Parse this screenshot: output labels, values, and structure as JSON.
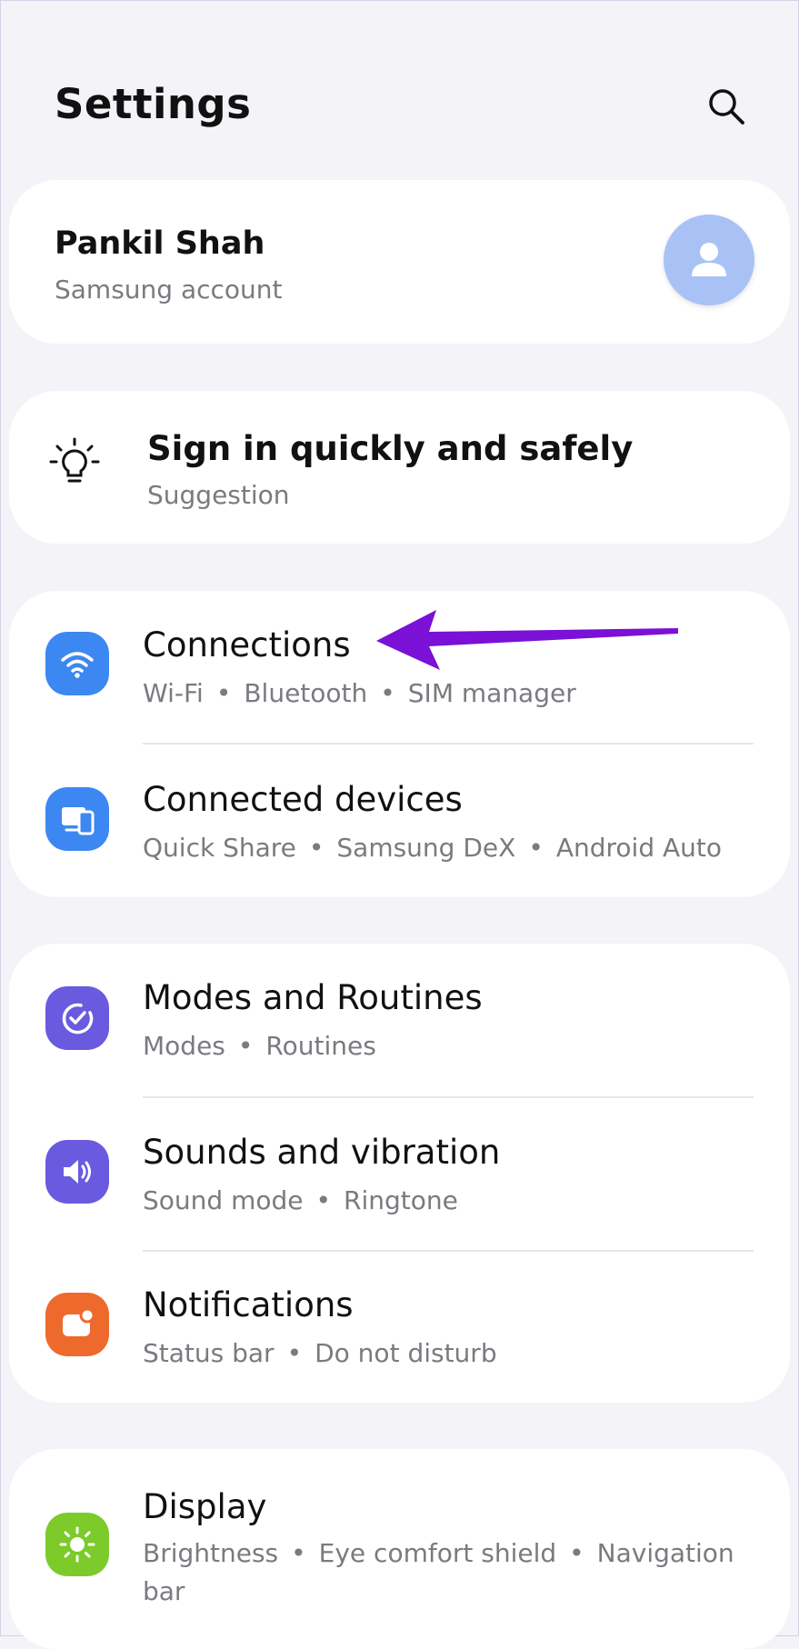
{
  "header": {
    "title": "Settings"
  },
  "account": {
    "name": "Pankil Shah",
    "subtitle": "Samsung account"
  },
  "suggestion": {
    "title": "Sign in quickly and safely",
    "subtitle": "Suggestion"
  },
  "groups": [
    {
      "items": [
        {
          "title": "Connections",
          "subs": [
            "Wi-Fi",
            "Bluetooth",
            "SIM manager"
          ],
          "icon": "wifi-icon",
          "color": "#3d87f2"
        },
        {
          "title": "Connected devices",
          "subs": [
            "Quick Share",
            "Samsung DeX",
            "Android Auto"
          ],
          "icon": "connected-devices-icon",
          "color": "#3d87f2"
        }
      ]
    },
    {
      "items": [
        {
          "title": "Modes and Routines",
          "subs": [
            "Modes",
            "Routines"
          ],
          "icon": "modes-routines-icon",
          "color": "#6a5ae0"
        },
        {
          "title": "Sounds and vibration",
          "subs": [
            "Sound mode",
            "Ringtone"
          ],
          "icon": "speaker-icon",
          "color": "#6a5ae0"
        },
        {
          "title": "Notifications",
          "subs": [
            "Status bar",
            "Do not disturb"
          ],
          "icon": "notifications-icon",
          "color": "#ee6a2c"
        }
      ]
    },
    {
      "items": [
        {
          "title": "Display",
          "subs": [
            "Brightness",
            "Eye comfort shield",
            "Navigation bar"
          ],
          "icon": "brightness-icon",
          "color": "#7ccb2a"
        }
      ]
    }
  ],
  "annotation": {
    "arrow_color": "#7b10d6"
  }
}
